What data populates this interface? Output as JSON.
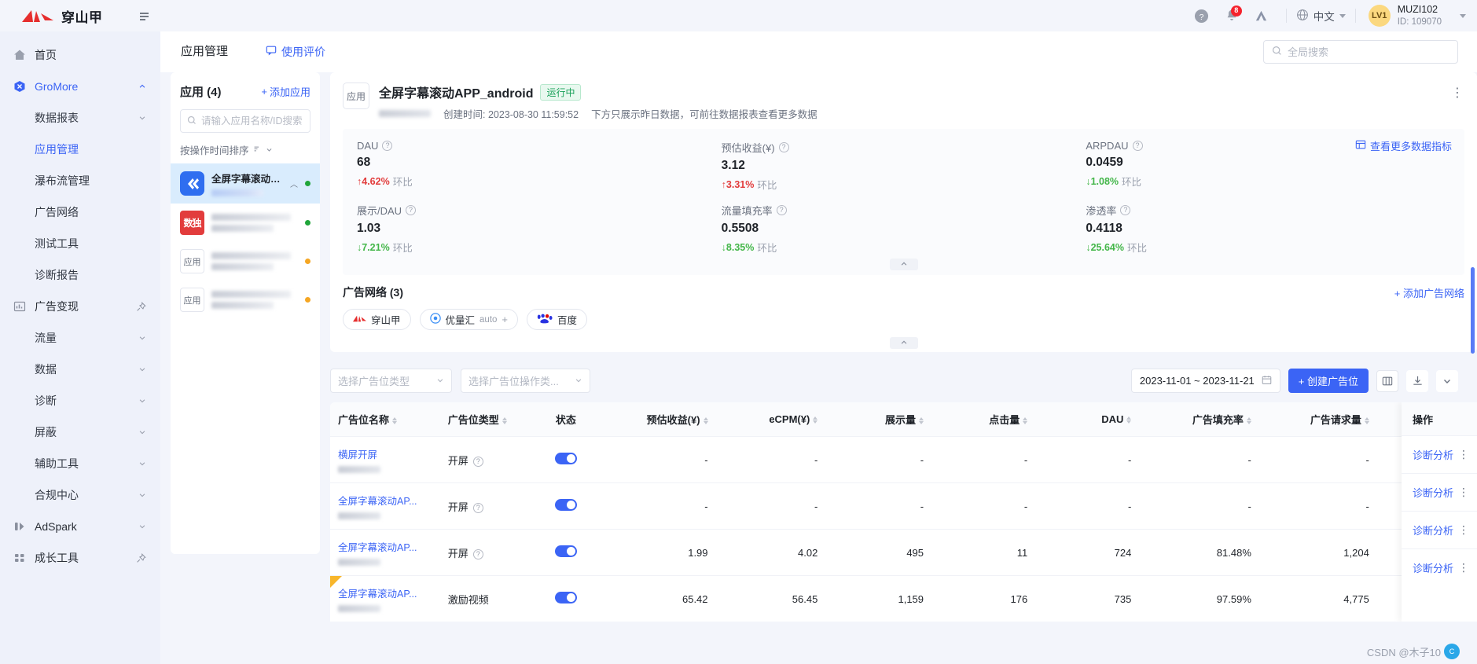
{
  "topbar": {
    "logo_text": "穿山甲",
    "collapse_icon": "collapse-sidebar-icon",
    "help_icon": "help-circle-icon",
    "bell_icon": "bell-icon",
    "notification_count": "8",
    "brand_icon": "adspark-triangle-icon",
    "globe_icon": "globe-icon",
    "language": "中文",
    "avatar_level": "LV1",
    "user_name": "MUZI102",
    "user_id": "ID: 109070"
  },
  "sidebar": {
    "items": [
      {
        "label": "首页",
        "icon": "home-icon",
        "level": 0,
        "state": "plain",
        "trailing": "none"
      },
      {
        "label": "GroMore",
        "icon": "gromore-icon",
        "level": 0,
        "state": "group-open",
        "trailing": "chevron-up"
      },
      {
        "label": "数据报表",
        "icon": "",
        "level": 1,
        "state": "plain",
        "trailing": "chevron-down"
      },
      {
        "label": "应用管理",
        "icon": "",
        "level": 1,
        "state": "active",
        "trailing": "none"
      },
      {
        "label": "瀑布流管理",
        "icon": "",
        "level": 1,
        "state": "plain",
        "trailing": "none"
      },
      {
        "label": "广告网络",
        "icon": "",
        "level": 1,
        "state": "plain",
        "trailing": "none"
      },
      {
        "label": "测试工具",
        "icon": "",
        "level": 1,
        "state": "plain",
        "trailing": "none"
      },
      {
        "label": "诊断报告",
        "icon": "",
        "level": 1,
        "state": "plain",
        "trailing": "none"
      },
      {
        "label": "广告变现",
        "icon": "chart-bars-icon",
        "level": 0,
        "state": "plain",
        "trailing": "pin"
      },
      {
        "label": "流量",
        "icon": "",
        "level": 1,
        "state": "plain",
        "trailing": "chevron-down"
      },
      {
        "label": "数据",
        "icon": "",
        "level": 1,
        "state": "plain",
        "trailing": "chevron-down"
      },
      {
        "label": "诊断",
        "icon": "",
        "level": 1,
        "state": "plain",
        "trailing": "chevron-down"
      },
      {
        "label": "屏蔽",
        "icon": "",
        "level": 1,
        "state": "plain",
        "trailing": "chevron-down"
      },
      {
        "label": "辅助工具",
        "icon": "",
        "level": 1,
        "state": "plain",
        "trailing": "chevron-down"
      },
      {
        "label": "合规中心",
        "icon": "",
        "level": 1,
        "state": "plain",
        "trailing": "chevron-down"
      },
      {
        "label": "AdSpark",
        "icon": "adspark-icon",
        "level": 0,
        "state": "plain",
        "trailing": "chevron-down"
      },
      {
        "label": "成长工具",
        "icon": "grid-icon",
        "level": 0,
        "state": "plain",
        "trailing": "pin"
      }
    ]
  },
  "tabs": [
    {
      "label": "应用管理",
      "active": true,
      "icon": ""
    },
    {
      "label": "使用评价",
      "active": false,
      "icon": "comment-icon"
    }
  ],
  "search": {
    "placeholder": "全局搜索",
    "value": "",
    "icon": "search-icon"
  },
  "app_panel": {
    "title": "应用 (4)",
    "add_label": "添加应用",
    "search_placeholder": "请输入应用名称/ID搜索",
    "sort_label": "按操作时间排序",
    "apps": [
      {
        "name": "全屏字幕滚动APP...",
        "icon_kind": "blue",
        "icon_text": "",
        "selected": true,
        "status": "green",
        "subtitle_blurred": true
      },
      {
        "name": "",
        "icon_kind": "red",
        "icon_text": "数独",
        "selected": false,
        "status": "green",
        "subtitle_blurred": true
      },
      {
        "name": "",
        "icon_kind": "plain",
        "icon_text": "应用",
        "selected": false,
        "status": "amber",
        "subtitle_blurred": true
      },
      {
        "name": "",
        "icon_kind": "plain",
        "icon_text": "应用",
        "selected": false,
        "status": "amber",
        "subtitle_blurred": true
      }
    ]
  },
  "detail": {
    "icon_text": "应用",
    "title": "全屏字幕滚动APP_android",
    "status_pill": "运行中",
    "created_label": "创建时间: 2023-08-30 11:59:52",
    "note": "下方只展示昨日数据，可前往数据报表查看更多数据",
    "more_metrics_label": "查看更多数据指标",
    "more_metrics_icon": "table-grid-icon",
    "kebab_icon": "more-vertical-icon",
    "metrics": [
      {
        "label": "DAU",
        "value": "68",
        "delta": "4.62%",
        "dir": "up",
        "compare": "环比"
      },
      {
        "label": "预估收益(¥)",
        "value": "3.12",
        "delta": "3.31%",
        "dir": "up",
        "compare": "环比"
      },
      {
        "label": "ARPDAU",
        "value": "0.0459",
        "delta": "1.08%",
        "dir": "down",
        "compare": "环比"
      },
      {
        "label": "展示/DAU",
        "value": "1.03",
        "delta": "7.21%",
        "dir": "down",
        "compare": "环比"
      },
      {
        "label": "流量填充率",
        "value": "0.5508",
        "delta": "8.35%",
        "dir": "down",
        "compare": "环比"
      },
      {
        "label": "渗透率",
        "value": "0.4118",
        "delta": "25.64%",
        "dir": "down",
        "compare": "环比"
      }
    ],
    "networks": {
      "title": "广告网络 (3)",
      "add_label": "+ 添加广告网络",
      "chips": [
        {
          "label": "穿山甲",
          "sub": "",
          "plus": false,
          "logo": "chuanshanjia-logo-icon"
        },
        {
          "label": "优量汇",
          "sub": "auto",
          "plus": true,
          "logo": "youlianghui-logo-icon"
        },
        {
          "label": "百度",
          "sub": "",
          "plus": false,
          "logo": "baidu-logo-icon"
        }
      ]
    }
  },
  "filters": {
    "slot_type_placeholder": "选择广告位类型",
    "slot_op_placeholder": "选择广告位操作类...",
    "date_range": "2023-11-01 ~ 2023-11-21",
    "calendar_icon": "calendar-icon",
    "create_btn": "+ 创建广告位",
    "columns_icon": "columns-settings-icon",
    "download_icon": "download-icon",
    "collapse_icon": "chevron-down-icon"
  },
  "table": {
    "columns": [
      {
        "label": "广告位名称",
        "sortable": true,
        "align": "l"
      },
      {
        "label": "广告位类型",
        "sortable": true,
        "align": "l"
      },
      {
        "label": "状态",
        "sortable": false,
        "align": "c"
      },
      {
        "label": "预估收益(¥)",
        "sortable": true,
        "align": "r"
      },
      {
        "label": "eCPM(¥)",
        "sortable": true,
        "align": "r"
      },
      {
        "label": "展示量",
        "sortable": true,
        "align": "r"
      },
      {
        "label": "点击量",
        "sortable": true,
        "align": "r"
      },
      {
        "label": "DAU",
        "sortable": true,
        "align": "r"
      },
      {
        "label": "广告填充率",
        "sortable": true,
        "align": "r"
      },
      {
        "label": "广告请求量",
        "sortable": true,
        "align": "r"
      }
    ],
    "operation_header": "操作",
    "operation_link": "诊断分析",
    "rows": [
      {
        "name": "横屏开屏",
        "type": "开屏",
        "has_help": true,
        "enabled": true,
        "revenue": "-",
        "ecpm": "-",
        "impressions": "-",
        "clicks": "-",
        "dau": "-",
        "fill_rate": "-",
        "requests": "-",
        "flag": false
      },
      {
        "name": "全屏字幕滚动AP...",
        "type": "开屏",
        "has_help": true,
        "enabled": true,
        "revenue": "-",
        "ecpm": "-",
        "impressions": "-",
        "clicks": "-",
        "dau": "-",
        "fill_rate": "-",
        "requests": "-",
        "flag": false
      },
      {
        "name": "全屏字幕滚动AP...",
        "type": "开屏",
        "has_help": true,
        "enabled": true,
        "revenue": "1.99",
        "ecpm": "4.02",
        "impressions": "495",
        "clicks": "11",
        "dau": "724",
        "fill_rate": "81.48%",
        "requests": "1,204",
        "flag": false
      },
      {
        "name": "全屏字幕滚动AP...",
        "type": "激励视频",
        "has_help": false,
        "enabled": true,
        "revenue": "65.42",
        "ecpm": "56.45",
        "impressions": "1,159",
        "clicks": "176",
        "dau": "735",
        "fill_rate": "97.59%",
        "requests": "4,775",
        "flag": true
      }
    ]
  },
  "watermark": "CSDN @木子10"
}
